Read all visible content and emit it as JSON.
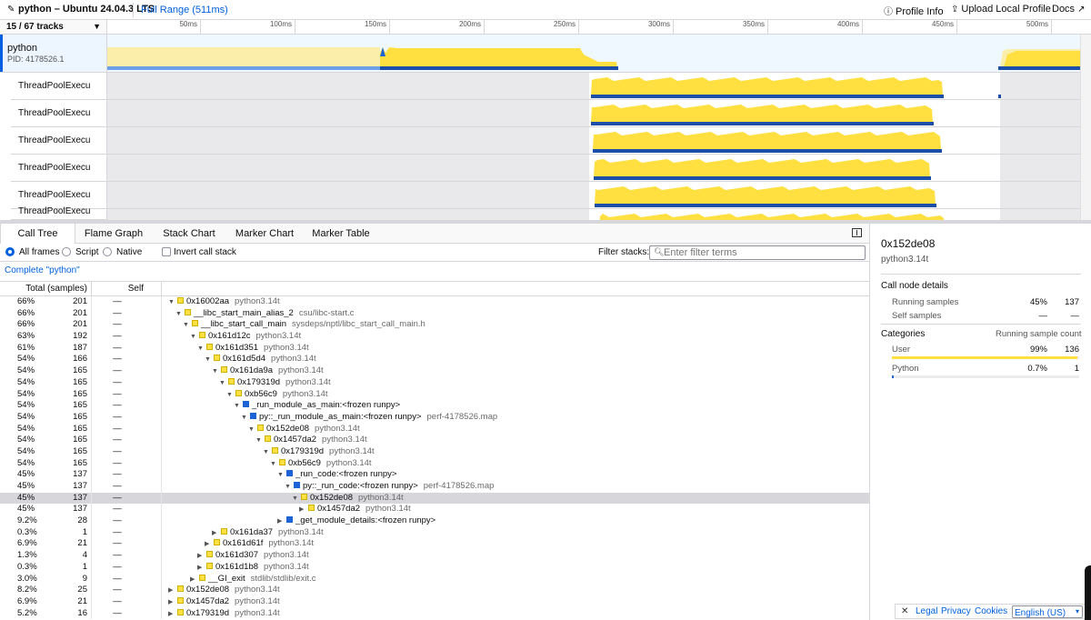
{
  "topbar": {
    "title": "python – Ubuntu 24.04.3 LTS",
    "range": "Full Range (511ms)",
    "profile_info": "Profile Info",
    "upload": "Upload Local Profile",
    "docs": "Docs"
  },
  "tracks": {
    "selector": "15 / 67 tracks",
    "ticks": [
      "50ms",
      "100ms",
      "150ms",
      "200ms",
      "250ms",
      "300ms",
      "350ms",
      "400ms",
      "450ms",
      "500ms"
    ],
    "main": {
      "name": "python",
      "pid": "PID: 4178526.1"
    },
    "threads": [
      "ThreadPoolExecu",
      "ThreadPoolExecu",
      "ThreadPoolExecu",
      "ThreadPoolExecu",
      "ThreadPoolExecu",
      "ThreadPoolExecu"
    ]
  },
  "tabs": [
    "Call Tree",
    "Flame Graph",
    "Stack Chart",
    "Marker Chart",
    "Marker Table"
  ],
  "settings": {
    "all_frames": "All frames",
    "script": "Script",
    "native": "Native",
    "invert": "Invert call stack",
    "filter_label": "Filter stacks:",
    "filter_placeholder": "Enter filter terms"
  },
  "breadcrumb": "Complete \"python\"",
  "tree_header": {
    "total": "Total (samples)",
    "self": "Self"
  },
  "rows": [
    {
      "pct": "66%",
      "n": "201",
      "self": "—",
      "depth": 0,
      "tw": "open",
      "c": "y",
      "name": "0x16002aa",
      "lib": "python3.14t"
    },
    {
      "pct": "66%",
      "n": "201",
      "self": "—",
      "depth": 1,
      "tw": "open",
      "c": "y",
      "name": "__libc_start_main_alias_2",
      "lib": "csu/libc-start.c"
    },
    {
      "pct": "66%",
      "n": "201",
      "self": "—",
      "depth": 2,
      "tw": "open",
      "c": "y",
      "name": "__libc_start_call_main",
      "lib": "sysdeps/nptl/libc_start_call_main.h"
    },
    {
      "pct": "63%",
      "n": "192",
      "self": "—",
      "depth": 3,
      "tw": "open",
      "c": "y",
      "name": "0x161d12c",
      "lib": "python3.14t"
    },
    {
      "pct": "61%",
      "n": "187",
      "self": "—",
      "depth": 4,
      "tw": "open",
      "c": "y",
      "name": "0x161d351",
      "lib": "python3.14t"
    },
    {
      "pct": "54%",
      "n": "166",
      "self": "—",
      "depth": 5,
      "tw": "open",
      "c": "y",
      "name": "0x161d5d4",
      "lib": "python3.14t"
    },
    {
      "pct": "54%",
      "n": "165",
      "self": "—",
      "depth": 6,
      "tw": "open",
      "c": "y",
      "name": "0x161da9a",
      "lib": "python3.14t"
    },
    {
      "pct": "54%",
      "n": "165",
      "self": "—",
      "depth": 7,
      "tw": "open",
      "c": "y",
      "name": "0x179319d",
      "lib": "python3.14t"
    },
    {
      "pct": "54%",
      "n": "165",
      "self": "—",
      "depth": 8,
      "tw": "open",
      "c": "y",
      "name": "0xb56c9",
      "lib": "python3.14t"
    },
    {
      "pct": "54%",
      "n": "165",
      "self": "—",
      "depth": 9,
      "tw": "open",
      "c": "b",
      "name": "_run_module_as_main:<frozen runpy>",
      "lib": ""
    },
    {
      "pct": "54%",
      "n": "165",
      "self": "—",
      "depth": 10,
      "tw": "open",
      "c": "b",
      "name": "py::_run_module_as_main:<frozen runpy>",
      "lib": "perf-4178526.map"
    },
    {
      "pct": "54%",
      "n": "165",
      "self": "—",
      "depth": 11,
      "tw": "open",
      "c": "y",
      "name": "0x152de08",
      "lib": "python3.14t"
    },
    {
      "pct": "54%",
      "n": "165",
      "self": "—",
      "depth": 12,
      "tw": "open",
      "c": "y",
      "name": "0x1457da2",
      "lib": "python3.14t"
    },
    {
      "pct": "54%",
      "n": "165",
      "self": "—",
      "depth": 13,
      "tw": "open",
      "c": "y",
      "name": "0x179319d",
      "lib": "python3.14t"
    },
    {
      "pct": "54%",
      "n": "165",
      "self": "—",
      "depth": 14,
      "tw": "open",
      "c": "y",
      "name": "0xb56c9",
      "lib": "python3.14t"
    },
    {
      "pct": "45%",
      "n": "137",
      "self": "—",
      "depth": 15,
      "tw": "open",
      "c": "b",
      "name": "_run_code:<frozen runpy>",
      "lib": ""
    },
    {
      "pct": "45%",
      "n": "137",
      "self": "—",
      "depth": 16,
      "tw": "open",
      "c": "b",
      "name": "py::_run_code:<frozen runpy>",
      "lib": "perf-4178526.map"
    },
    {
      "pct": "45%",
      "n": "137",
      "self": "—",
      "depth": 17,
      "tw": "open",
      "c": "y",
      "name": "0x152de08",
      "lib": "python3.14t",
      "selected": true
    },
    {
      "pct": "45%",
      "n": "137",
      "self": "—",
      "depth": 18,
      "tw": "closed",
      "c": "y",
      "name": "0x1457da2",
      "lib": "python3.14t"
    },
    {
      "pct": "9.2%",
      "n": "28",
      "self": "—",
      "depth": 15,
      "tw": "closed",
      "c": "b",
      "name": "_get_module_details:<frozen runpy>",
      "lib": ""
    },
    {
      "pct": "0.3%",
      "n": "1",
      "self": "—",
      "depth": 6,
      "tw": "closed",
      "c": "y",
      "name": "0x161da37",
      "lib": "python3.14t"
    },
    {
      "pct": "6.9%",
      "n": "21",
      "self": "—",
      "depth": 5,
      "tw": "closed",
      "c": "y",
      "name": "0x161d61f",
      "lib": "python3.14t"
    },
    {
      "pct": "1.3%",
      "n": "4",
      "self": "—",
      "depth": 4,
      "tw": "closed",
      "c": "y",
      "name": "0x161d307",
      "lib": "python3.14t"
    },
    {
      "pct": "0.3%",
      "n": "1",
      "self": "—",
      "depth": 4,
      "tw": "closed",
      "c": "y",
      "name": "0x161d1b8",
      "lib": "python3.14t"
    },
    {
      "pct": "3.0%",
      "n": "9",
      "self": "—",
      "depth": 3,
      "tw": "closed",
      "c": "y",
      "name": "__GI_exit",
      "lib": "stdlib/stdlib/exit.c"
    },
    {
      "pct": "8.2%",
      "n": "25",
      "self": "—",
      "depth": 0,
      "tw": "closed",
      "c": "y",
      "name": "0x152de08",
      "lib": "python3.14t"
    },
    {
      "pct": "6.9%",
      "n": "21",
      "self": "—",
      "depth": 0,
      "tw": "closed",
      "c": "y",
      "name": "0x1457da2",
      "lib": "python3.14t"
    },
    {
      "pct": "5.2%",
      "n": "16",
      "self": "—",
      "depth": 0,
      "tw": "closed",
      "c": "y",
      "name": "0x179319d",
      "lib": "python3.14t"
    }
  ],
  "sidebar": {
    "title": "0x152de08",
    "subtitle": "python3.14t",
    "details_title": "Call node details",
    "running_label": "Running samples",
    "running_pct": "45%",
    "running_n": "137",
    "self_label": "Self samples",
    "self_pct": "—",
    "self_n": "—",
    "categories_title": "Categories",
    "categories_col": "Running sample count",
    "categories": [
      {
        "name": "User",
        "pct": "99%",
        "n": "136",
        "fraction": 0.99,
        "color": "#ffe040"
      },
      {
        "name": "Python",
        "pct": "0.7%",
        "n": "1",
        "fraction": 0.007,
        "color": "#1e63d6"
      }
    ]
  },
  "footer": {
    "legal": "Legal",
    "privacy": "Privacy",
    "cookies": "Cookies",
    "language": "English (US)"
  },
  "colors": {
    "accent": "#0060df",
    "user": "#ffe040",
    "python": "#1e63d6"
  }
}
